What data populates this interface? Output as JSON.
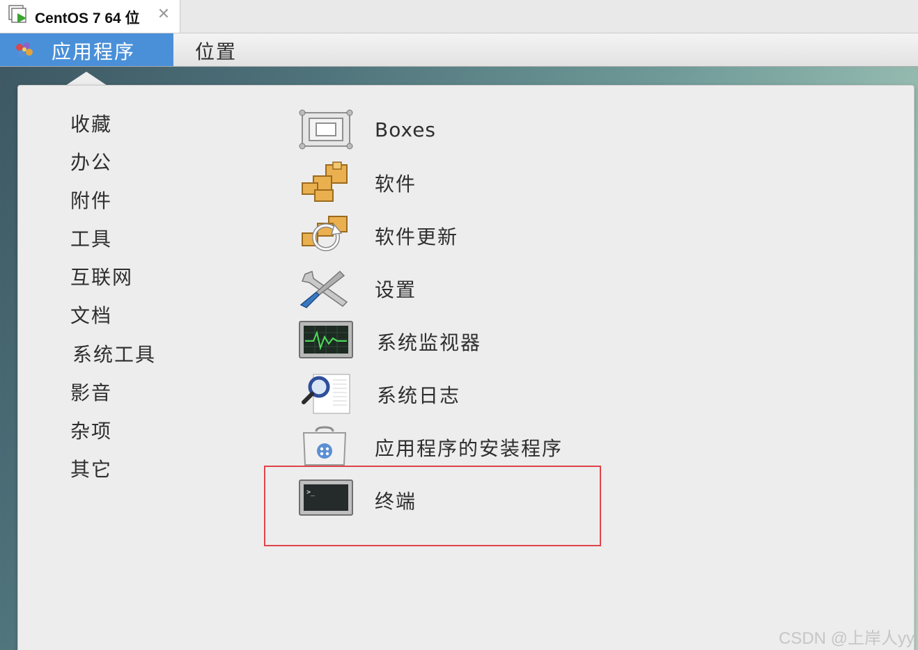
{
  "vm_tab": {
    "title": "CentOS 7 64 位",
    "close_glyph": "✕"
  },
  "topbar": {
    "applications_label": "应用程序",
    "places_label": "位置"
  },
  "categories": [
    "收藏",
    "办公",
    "附件",
    "工具",
    "互联网",
    "文档",
    "系统工具",
    "影音",
    "杂项",
    "其它"
  ],
  "apps": [
    {
      "label": "Boxes",
      "icon": "boxes-icon"
    },
    {
      "label": "软件",
      "icon": "software-icon"
    },
    {
      "label": "软件更新",
      "icon": "software-update-icon"
    },
    {
      "label": "设置",
      "icon": "settings-icon"
    },
    {
      "label": "系统监视器",
      "icon": "system-monitor-icon"
    },
    {
      "label": "系统日志",
      "icon": "system-log-icon"
    },
    {
      "label": "应用程序的安装程序",
      "icon": "app-installer-icon"
    },
    {
      "label": "终端",
      "icon": "terminal-icon"
    }
  ],
  "highlighted_app": "终端",
  "colors": {
    "accent": "#4a90d9",
    "highlight_border": "#e0434a"
  },
  "watermark": "CSDN @上岸人yy"
}
